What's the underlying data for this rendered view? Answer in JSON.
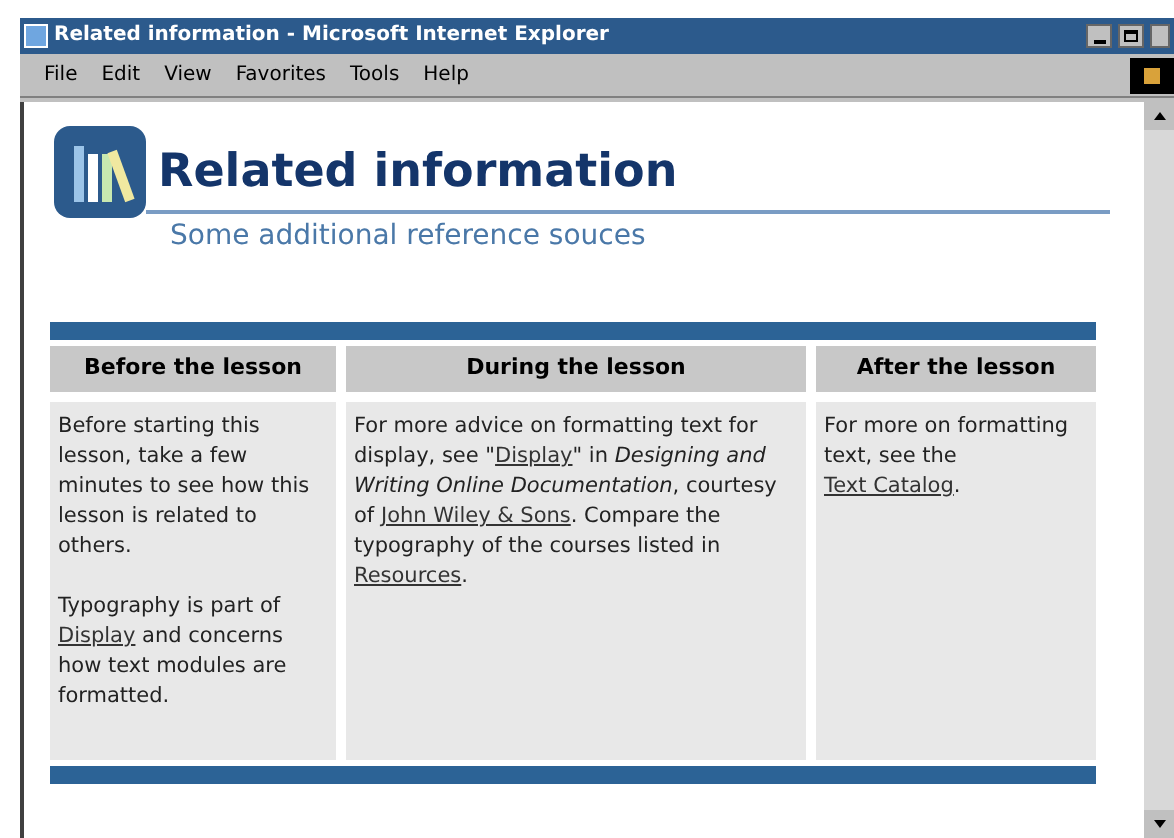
{
  "window": {
    "title": "Related information - Microsoft Internet Explorer"
  },
  "menu": [
    "File",
    "Edit",
    "View",
    "Favorites",
    "Tools",
    "Help"
  ],
  "page": {
    "title": "Related information",
    "subtitle": "Some additional reference souces"
  },
  "columns": [
    {
      "heading": "Before the lesson",
      "paragraphs": [
        [
          {
            "kind": "text",
            "text": "Before starting this lesson, take a few minutes to see how this lesson is related to others."
          }
        ],
        [
          {
            "kind": "text",
            "text": "Typography is part of "
          },
          {
            "kind": "link",
            "text": "Display"
          },
          {
            "kind": "text",
            "text": " and concerns how text modules are formatted."
          }
        ]
      ]
    },
    {
      "heading": "During the lesson",
      "paragraphs": [
        [
          {
            "kind": "text",
            "text": "For more advice on formatting text for display, see \""
          },
          {
            "kind": "link",
            "text": "Display"
          },
          {
            "kind": "text",
            "text": "\" in "
          },
          {
            "kind": "italic",
            "text": "Designing and Writing Online Documentation"
          },
          {
            "kind": "text",
            "text": ", courtesy of "
          },
          {
            "kind": "link",
            "text": "John Wiley & Sons"
          },
          {
            "kind": "text",
            "text": ". Compare the typography of the courses listed in "
          },
          {
            "kind": "link",
            "text": "Resources"
          },
          {
            "kind": "text",
            "text": "."
          }
        ]
      ]
    },
    {
      "heading": "After the lesson",
      "paragraphs": [
        [
          {
            "kind": "text",
            "text": "For more on formatting text, see the "
          },
          {
            "kind": "link",
            "text": "Text Catalog"
          },
          {
            "kind": "text",
            "text": "."
          }
        ]
      ]
    }
  ]
}
